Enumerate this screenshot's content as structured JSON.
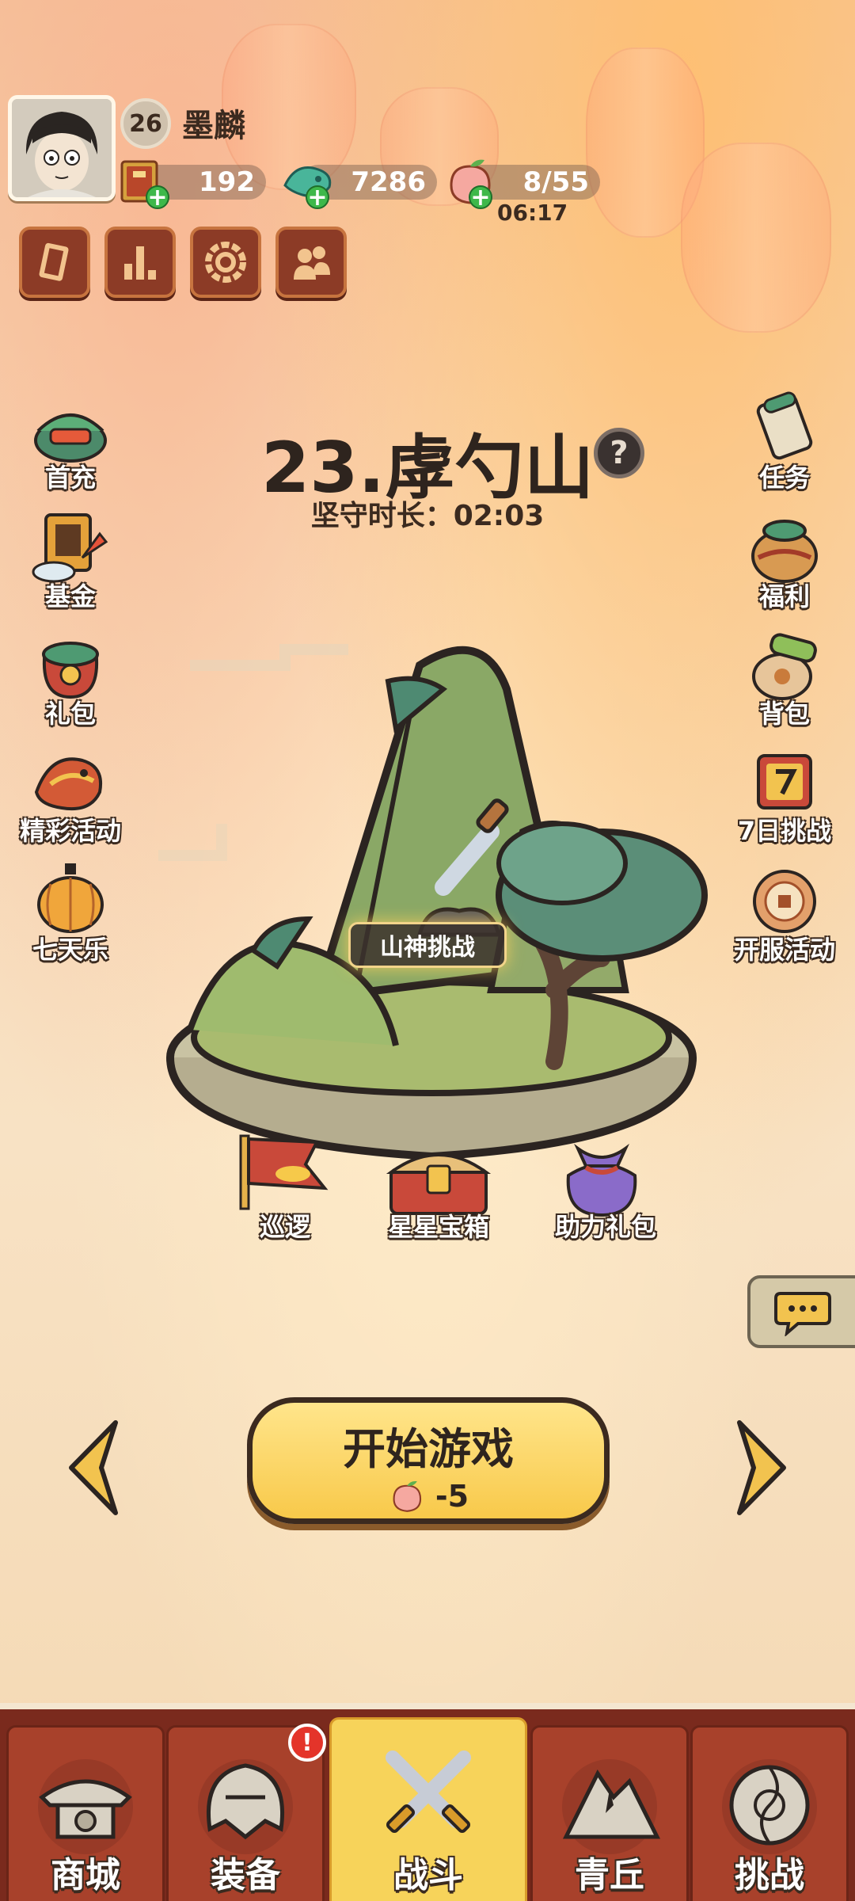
{
  "player": {
    "level": "26",
    "name": "墨麟"
  },
  "resources": {
    "tickets": "192",
    "jade": "7286",
    "stamina": "8/55",
    "stamina_timer": "06:17"
  },
  "toolbar_icons": [
    "card-icon",
    "ranking-icon",
    "settings-icon",
    "friends-icon"
  ],
  "left_menu": [
    {
      "label": "首充",
      "icon": "treasure-pot-icon"
    },
    {
      "label": "基金",
      "icon": "fund-book-icon"
    },
    {
      "label": "礼包",
      "icon": "gift-bag-icon"
    },
    {
      "label": "精彩活动",
      "icon": "dragon-event-icon"
    },
    {
      "label": "七天乐",
      "icon": "lantern-icon"
    }
  ],
  "right_menu": [
    {
      "label": "任务",
      "icon": "scroll-icon"
    },
    {
      "label": "福利",
      "icon": "welfare-bag-icon"
    },
    {
      "label": "背包",
      "icon": "backpack-icon"
    },
    {
      "label": "7日挑战",
      "icon": "seven-day-icon"
    },
    {
      "label": "开服活动",
      "icon": "server-event-icon"
    }
  ],
  "stage": {
    "title": "23.虖勺山",
    "guard_time": "坚守时长：02:03"
  },
  "map_features": {
    "mountain_challenge": "山神挑战",
    "patrol": "巡逻",
    "star_chest": "星星宝箱",
    "assist_gift": "助力礼包"
  },
  "start": {
    "label": "开始游戏",
    "cost": "-5"
  },
  "bottom_nav": [
    {
      "label": "商城",
      "icon": "shop-icon"
    },
    {
      "label": "装备",
      "icon": "equipment-helmet-icon"
    },
    {
      "label": "战斗",
      "icon": "crossed-swords-icon"
    },
    {
      "label": "青丘",
      "icon": "qingqiu-mountain-icon"
    },
    {
      "label": "挑战",
      "icon": "challenge-disc-icon"
    }
  ],
  "alerts": {
    "equipment_badge": "!"
  },
  "colors": {
    "accent_yellow": "#f7d35a",
    "nav_red": "#a8412b",
    "dark_text": "#2e241e"
  }
}
